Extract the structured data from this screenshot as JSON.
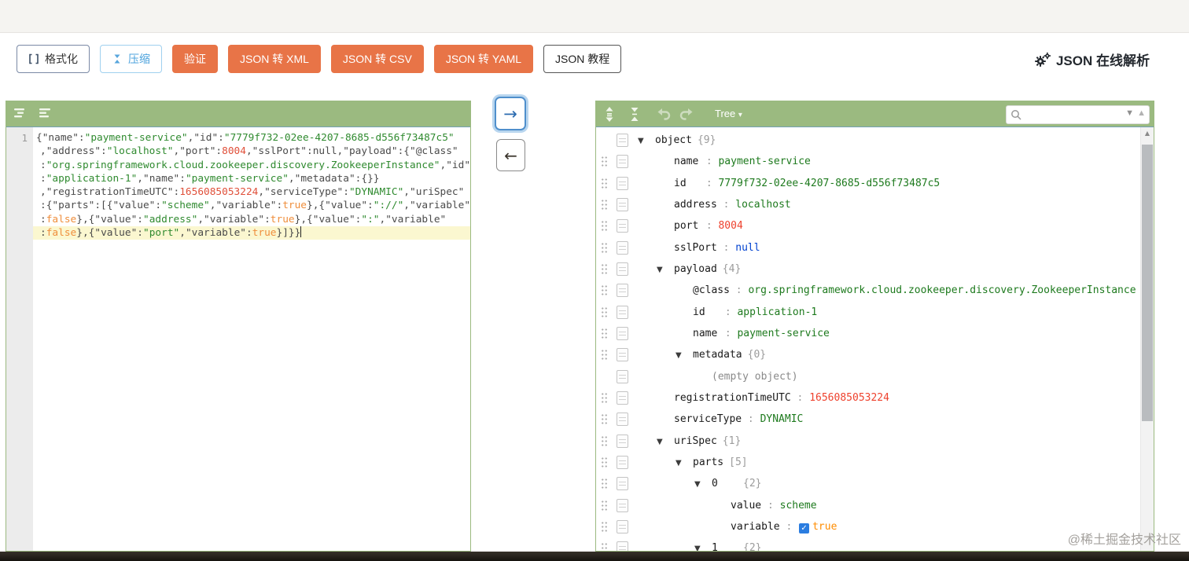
{
  "toolbar": {
    "format_label": "格式化",
    "compress_label": "压缩",
    "validate_label": "验证",
    "to_xml_label": "JSON 转 XML",
    "to_csv_label": "JSON 转 CSV",
    "to_yaml_label": "JSON 转 YAML",
    "tutorial_label": "JSON 教程",
    "brand_label": "JSON 在线解析"
  },
  "editor": {
    "line_number": "1",
    "active_line": 7,
    "lines": [
      [
        [
          "k",
          "{\"name\":"
        ],
        [
          "s",
          "\"payment-service\""
        ],
        [
          "k",
          ",\"id\":"
        ],
        [
          "s",
          "\"7779f732-02ee-4207-8685-d556f73487c5\""
        ]
      ],
      [
        [
          "k",
          ",\"address\":"
        ],
        [
          "s",
          "\"localhost\""
        ],
        [
          "k",
          ",\"port\":"
        ],
        [
          "n",
          "8004"
        ],
        [
          "k",
          ",\"sslPort\":"
        ],
        [
          "u",
          "null"
        ],
        [
          "k",
          ",\"payload\":{\"@class\""
        ]
      ],
      [
        [
          "k",
          ":"
        ],
        [
          "s",
          "\"org.springframework.cloud.zookeeper.discovery.ZookeeperInstance\""
        ],
        [
          "k",
          ",\"id\""
        ]
      ],
      [
        [
          "k",
          ":"
        ],
        [
          "s",
          "\"application-1\""
        ],
        [
          "k",
          ",\"name\":"
        ],
        [
          "s",
          "\"payment-service\""
        ],
        [
          "k",
          ",\"metadata\":{}}"
        ]
      ],
      [
        [
          "k",
          ",\"registrationTimeUTC\":"
        ],
        [
          "n",
          "1656085053224"
        ],
        [
          "k",
          ",\"serviceType\":"
        ],
        [
          "s",
          "\"DYNAMIC\""
        ],
        [
          "k",
          ",\"uriSpec\""
        ]
      ],
      [
        [
          "k",
          ":{\"parts\":[{\"value\":"
        ],
        [
          "s",
          "\"scheme\""
        ],
        [
          "k",
          ",\"variable\":"
        ],
        [
          "b",
          "true"
        ],
        [
          "k",
          "},{\"value\":"
        ],
        [
          "s",
          "\"://\""
        ],
        [
          "k",
          ",\"variable\""
        ]
      ],
      [
        [
          "k",
          ":"
        ],
        [
          "b",
          "false"
        ],
        [
          "k",
          "},{\"value\":"
        ],
        [
          "s",
          "\"address\""
        ],
        [
          "k",
          ",\"variable\":"
        ],
        [
          "b",
          "true"
        ],
        [
          "k",
          "},{\"value\":"
        ],
        [
          "s",
          "\":\""
        ],
        [
          "k",
          ",\"variable\""
        ]
      ],
      [
        [
          "k",
          ":"
        ],
        [
          "b",
          "false"
        ],
        [
          "k",
          "},{\"value\":"
        ],
        [
          "s",
          "\"port\""
        ],
        [
          "k",
          ",\"variable\":"
        ],
        [
          "b",
          "true"
        ],
        [
          "k",
          "}]}}"
        ]
      ]
    ]
  },
  "transfer": {
    "to_right_label": "→",
    "to_left_label": "←"
  },
  "tree": {
    "mode_label": "Tree",
    "mode_caret": "▾",
    "search_value": "",
    "search_next_icon": "▼",
    "search_prev_icon": "▲",
    "scroll_up_icon": "▲",
    "icons": {
      "collapse": "▼",
      "check": "✓"
    },
    "rows": [
      {
        "lvl": 0,
        "exp": true,
        "field": "object",
        "count": "{9}",
        "handle": false
      },
      {
        "lvl": 1,
        "field": "name",
        "value": "payment-service",
        "vt": "str",
        "handle": true
      },
      {
        "lvl": 1,
        "field": "id",
        "value": "7779f732-02ee-4207-8685-d556f73487c5",
        "vt": "str",
        "handle": true
      },
      {
        "lvl": 1,
        "field": "address",
        "value": "localhost",
        "vt": "str",
        "handle": true
      },
      {
        "lvl": 1,
        "field": "port",
        "value": "8004",
        "vt": "num",
        "handle": true
      },
      {
        "lvl": 1,
        "field": "sslPort",
        "value": "null",
        "vt": "null",
        "handle": true
      },
      {
        "lvl": 1,
        "exp": true,
        "field": "payload",
        "count": "{4}",
        "handle": true
      },
      {
        "lvl": 2,
        "field": "@class",
        "value": "org.springframework.cloud.zookeeper.discovery.ZookeeperInstance",
        "vt": "str",
        "handle": true
      },
      {
        "lvl": 2,
        "field": "id",
        "value": "application-1",
        "vt": "str",
        "handle": true
      },
      {
        "lvl": 2,
        "field": "name",
        "value": "payment-service",
        "vt": "str",
        "handle": true
      },
      {
        "lvl": 2,
        "exp": true,
        "field": "metadata",
        "count": "{0}",
        "handle": true
      },
      {
        "lvl": 3,
        "empty": "(empty object)",
        "handle": false
      },
      {
        "lvl": 1,
        "field": "registrationTimeUTC",
        "value": "1656085053224",
        "vt": "num",
        "handle": true
      },
      {
        "lvl": 1,
        "field": "serviceType",
        "value": "DYNAMIC",
        "vt": "str",
        "handle": true
      },
      {
        "lvl": 1,
        "exp": true,
        "field": "uriSpec",
        "count": "{1}",
        "handle": true
      },
      {
        "lvl": 2,
        "exp": true,
        "field": "parts",
        "count": "[5]",
        "handle": true
      },
      {
        "lvl": 3,
        "exp": true,
        "field": "0",
        "count": "{2}",
        "handle": true
      },
      {
        "lvl": 4,
        "field": "value",
        "value": "scheme",
        "vt": "str",
        "handle": true
      },
      {
        "lvl": 4,
        "field": "variable",
        "value": "true",
        "vt": "bool",
        "checkbox": true,
        "handle": true
      },
      {
        "lvl": 3,
        "exp": true,
        "field": "1",
        "count": "{2}",
        "handle": true
      }
    ]
  },
  "watermark": {
    "text": "@稀土掘金技术社区"
  },
  "colors": {
    "accent_green": "#9bba80",
    "button_orange": "#e87447",
    "string_value": "#1e7a1e",
    "number_value": "#ee422e",
    "null_value": "#0041d0",
    "boolean_value": "#ff8c00",
    "line_highlight": "#fbf7d0"
  }
}
